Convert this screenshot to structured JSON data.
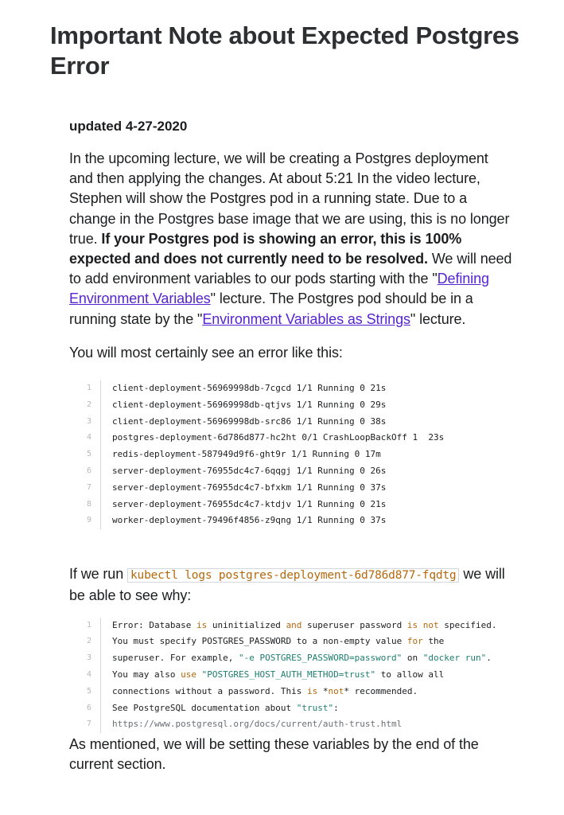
{
  "title": "Important Note about Expected Postgres Error",
  "updated": "updated 4-27-2020",
  "intro": {
    "part1": "In the upcoming lecture, we will be creating a Postgres deployment and then applying the changes. At about 5:21 In the video lecture, Stephen will show the Postgres pod in a running state. Due to a change in the Postgres base image that we are using, this is no longer true. ",
    "bold": "If your Postgres pod is showing an error, this is 100% expected and does not currently need to be resolved.",
    "part2": " We will need to add environment variables to our pods starting with the \"",
    "link1": "Defining Environment Variables",
    "part3": "\" lecture. The Postgres pod should be in a running state by the \"",
    "link2": "Environment Variables as Strings",
    "part4": "\" lecture."
  },
  "see_error": "You will most certainly see an error like this:",
  "pods_code": {
    "line_numbers": [
      "1",
      "2",
      "3",
      "4",
      "5",
      "6",
      "7",
      "8",
      "9"
    ],
    "lines": [
      "client-deployment-56969998db-7cgcd 1/1 Running 0 21s",
      "client-deployment-56969998db-qtjvs 1/1 Running 0 29s",
      "client-deployment-56969998db-src86 1/1 Running 0 38s",
      "postgres-deployment-6d786d877-hc2ht 0/1 CrashLoopBackOff 1  23s",
      "redis-deployment-587949d9f6-ght9r 1/1 Running 0 17m",
      "server-deployment-76955dc4c7-6qqgj 1/1 Running 0 26s",
      "server-deployment-76955dc4c7-bfxkm 1/1 Running 0 37s",
      "server-deployment-76955dc4c7-ktdjv 1/1 Running 0 21s",
      "worker-deployment-79496f4856-z9qng 1/1 Running 0 37s"
    ]
  },
  "run": {
    "prefix": "If we run ",
    "command": "kubectl logs postgres-deployment-6d786d877-fqdtg",
    "suffix": " we will be able to see why:"
  },
  "logs_code": {
    "line_numbers": [
      "1",
      "2",
      "3",
      "4",
      "5",
      "6",
      "7"
    ],
    "l1": {
      "a": "Error: Database ",
      "k1": "is",
      "b": " uninitialized ",
      "k2": "and",
      "c": " superuser password ",
      "k3": "is",
      "d": " ",
      "k4": "not",
      "e": " specified."
    },
    "l2": {
      "a": "You must specify POSTGRES_PASSWORD to a non-empty value ",
      "k1": "for",
      "b": " the"
    },
    "l3": {
      "a": "superuser. For example, ",
      "s1": "\"-e POSTGRES_PASSWORD=password\"",
      "b": " on ",
      "s2": "\"docker run\"",
      "c": "."
    },
    "l4": {
      "a": "You may also ",
      "k1": "use",
      "b": " ",
      "s1": "\"POSTGRES_HOST_AUTH_METHOD=trust\"",
      "c": " to allow all"
    },
    "l5": {
      "a": "connections without a password. This ",
      "k1": "is",
      "b": " *",
      "k2": "not",
      "c": "* recommended."
    },
    "l6": {
      "a": "See PostgreSQL documentation about ",
      "s1": "\"trust\"",
      "b": ":"
    },
    "l7": {
      "url": "https://www.postgresql.org/docs/current/auth-trust.html"
    }
  },
  "closing": "As mentioned, we will be setting these variables by the end of the current section.",
  "colors": {
    "link": "#5624d0",
    "keyword": "#b4690e",
    "string": "#1d7e6e",
    "text": "#1c1d1f",
    "line_number": "#b5b7ba"
  }
}
